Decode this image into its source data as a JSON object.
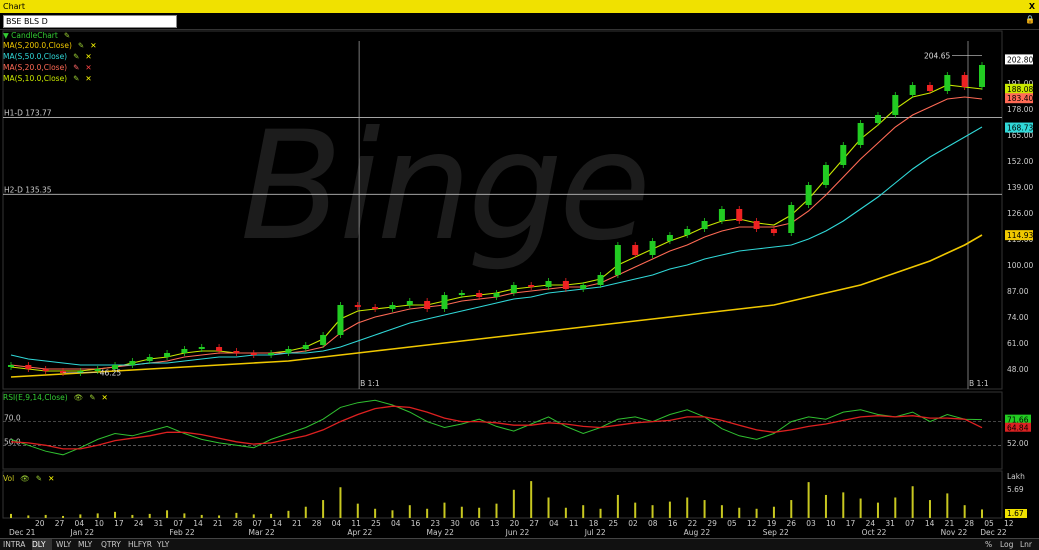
{
  "window": {
    "title": "Chart",
    "close_label": "X"
  },
  "symbol": {
    "value": "BSE BLS D"
  },
  "indicators": {
    "candle": "CandleChart",
    "ma200": "MA(S,200.0,Close)",
    "ma50": "MA(S,50.0,Close)",
    "ma20": "MA(S,20.0,Close)",
    "ma10": "MA(S,10.0,Close)",
    "rsi": "RSI(E,9,14,Close)",
    "vol": "Vol"
  },
  "watermark": "Binge",
  "colors": {
    "up": "#22cc22",
    "down": "#ee2222",
    "ma200": "#f0c800",
    "ma50": "#30d8d8",
    "ma20": "#ff6a55",
    "ma10": "#c8e800",
    "rsi_line": "#30c030",
    "rsi_avg": "#dd2020",
    "volume": "#c8c820",
    "titlebar": "#f0e100"
  },
  "chart_data": [
    {
      "type": "candlestick",
      "title": "BSE BLS D",
      "y_ticks": [
        202.8,
        191.0,
        178.0,
        165.0,
        152.0,
        139.0,
        126.0,
        113.0,
        100.0,
        87.0,
        74.0,
        61.0,
        48.0
      ],
      "ylim": [
        38,
        212
      ],
      "x_tick_labels": [
        "20",
        "27",
        "04",
        "10",
        "17",
        "24",
        "31",
        "07",
        "14",
        "21",
        "28",
        "07",
        "14",
        "21",
        "28",
        "04",
        "11",
        "25",
        "04",
        "16",
        "23",
        "30",
        "06",
        "13",
        "20",
        "27",
        "04",
        "11",
        "18",
        "25",
        "02",
        "08",
        "16",
        "22",
        "29",
        "05",
        "12",
        "19",
        "26",
        "03",
        "10",
        "17",
        "24",
        "31",
        "07",
        "14",
        "21",
        "28",
        "05",
        "12"
      ],
      "month_labels": [
        "Dec 21",
        "Jan 22",
        "Feb 22",
        "Mar 22",
        "Apr 22",
        "May 22",
        "Jun 22",
        "Jul 22",
        "Aug 22",
        "Sep 22",
        "Oct 22",
        "Nov 22",
        "Dec 22"
      ],
      "horizontal_lines": [
        {
          "label": "H1-D 173.77",
          "value": 173.77
        },
        {
          "label": "H2-D 135.35",
          "value": 135.35
        }
      ],
      "annotations": [
        {
          "text": "204.65",
          "value": 204.65
        },
        {
          "text": "46.25",
          "value": 46.25
        }
      ],
      "vertical_markers": [
        "B 1:1",
        "B 1:1"
      ],
      "last_value_labels": {
        "price_high": "202.80",
        "ma10": "188.08",
        "ma20": "183.40",
        "ma50": "168.73",
        "ma200": "114.93"
      },
      "series": [
        {
          "name": "CandleChart",
          "values": [
            50,
            48,
            47,
            46,
            47,
            48,
            50,
            52,
            54,
            56,
            58,
            59,
            57,
            56,
            55,
            56,
            58,
            60,
            65,
            80,
            79,
            78,
            80,
            82,
            78,
            85,
            86,
            84,
            86,
            90,
            89,
            92,
            88,
            90,
            95,
            110,
            105,
            112,
            115,
            118,
            122,
            128,
            122,
            118,
            116,
            130,
            140,
            150,
            160,
            171,
            175,
            185,
            190,
            187,
            195,
            189,
            200
          ]
        },
        {
          "name": "MA(S,10.0,Close)",
          "values": [
            49,
            48,
            47,
            47,
            47,
            48,
            49,
            51,
            53,
            54,
            56,
            57,
            57,
            56,
            56,
            56,
            57,
            59,
            63,
            73,
            77,
            78,
            79,
            80,
            80,
            82,
            84,
            85,
            86,
            88,
            89,
            90,
            90,
            91,
            93,
            100,
            104,
            108,
            112,
            115,
            119,
            122,
            123,
            121,
            120,
            125,
            133,
            143,
            153,
            163,
            170,
            178,
            184,
            186,
            190,
            189,
            188
          ]
        },
        {
          "name": "MA(S,20.0,Close)",
          "values": [
            50,
            49,
            48,
            48,
            48,
            48,
            49,
            50,
            51,
            52,
            54,
            55,
            56,
            56,
            56,
            56,
            56,
            57,
            59,
            66,
            71,
            74,
            76,
            78,
            79,
            80,
            82,
            83,
            84,
            86,
            87,
            88,
            89,
            89,
            91,
            95,
            99,
            103,
            107,
            110,
            114,
            117,
            119,
            119,
            119,
            121,
            127,
            135,
            144,
            153,
            161,
            169,
            175,
            179,
            183,
            184,
            183
          ]
        },
        {
          "name": "MA(S,50.0,Close)",
          "values": [
            55,
            53,
            52,
            51,
            50,
            50,
            50,
            50,
            51,
            51,
            52,
            53,
            54,
            54,
            55,
            55,
            56,
            56,
            57,
            59,
            62,
            65,
            68,
            71,
            73,
            75,
            77,
            79,
            81,
            83,
            84,
            86,
            87,
            88,
            89,
            91,
            93,
            95,
            98,
            100,
            103,
            105,
            107,
            108,
            109,
            110,
            113,
            117,
            122,
            128,
            134,
            141,
            148,
            154,
            159,
            164,
            169
          ]
        },
        {
          "name": "MA(S,200.0,Close)",
          "values": [
            44,
            44.5,
            45,
            45.5,
            46,
            46.5,
            47,
            47.5,
            48,
            48.5,
            49,
            49.5,
            50,
            50.5,
            51,
            51.5,
            52,
            53,
            54,
            55,
            56,
            57,
            58,
            59,
            60,
            61,
            62,
            63,
            64,
            65,
            66,
            67,
            68,
            69,
            70,
            71,
            72,
            73,
            74,
            75,
            76,
            77,
            78,
            79,
            80,
            82,
            84,
            86,
            88,
            90,
            93,
            96,
            99,
            102,
            106,
            110,
            115
          ]
        }
      ]
    },
    {
      "type": "line",
      "title": "RSI(E,9,14,Close)",
      "y_ticks": [
        70.0,
        50.0
      ],
      "right_labels": [
        "71.66",
        "64.84",
        "52.00"
      ],
      "series": [
        {
          "name": "RSI",
          "values": [
            55,
            50,
            45,
            42,
            48,
            55,
            60,
            58,
            62,
            66,
            60,
            55,
            52,
            50,
            48,
            55,
            60,
            65,
            72,
            82,
            86,
            88,
            84,
            78,
            70,
            65,
            68,
            72,
            66,
            62,
            68,
            74,
            66,
            60,
            65,
            72,
            74,
            70,
            76,
            80,
            74,
            64,
            58,
            55,
            60,
            70,
            74,
            72,
            78,
            80,
            76,
            74,
            78,
            70,
            76,
            72,
            71.66
          ]
        },
        {
          "name": "Average",
          "values": [
            53,
            52,
            50,
            47,
            47,
            50,
            54,
            56,
            58,
            61,
            61,
            59,
            56,
            53,
            51,
            52,
            55,
            58,
            63,
            70,
            76,
            81,
            83,
            82,
            78,
            73,
            70,
            70,
            69,
            67,
            67,
            69,
            68,
            66,
            65,
            67,
            69,
            70,
            71,
            74,
            74,
            71,
            67,
            63,
            61,
            63,
            66,
            68,
            71,
            74,
            75,
            74,
            75,
            73,
            73,
            72,
            64.84
          ]
        }
      ]
    },
    {
      "type": "bar",
      "title": "Vol",
      "y_ticks": [
        5.69
      ],
      "y_unit": "Lakh",
      "right_labels": [
        "1.67"
      ],
      "series": [
        {
          "name": "Vol",
          "values": [
            0.8,
            0.5,
            0.6,
            0.4,
            0.7,
            0.9,
            1.2,
            0.6,
            0.8,
            1.5,
            0.9,
            0.6,
            0.5,
            1.0,
            0.7,
            0.8,
            1.4,
            2.2,
            3.5,
            6.0,
            2.8,
            1.8,
            1.5,
            2.5,
            1.8,
            3.0,
            2.2,
            2.0,
            2.8,
            5.5,
            7.2,
            4.0,
            2.0,
            2.5,
            1.8,
            4.5,
            3.0,
            2.5,
            3.2,
            4.0,
            3.5,
            2.5,
            2.0,
            1.8,
            2.2,
            3.5,
            7.0,
            4.5,
            5.0,
            3.8,
            3.0,
            4.0,
            6.2,
            3.5,
            4.8,
            2.5,
            1.67
          ]
        }
      ]
    }
  ],
  "bottom_tabs": [
    "INTRA",
    "DLY",
    "WLY",
    "MLY",
    "QTRY",
    "HLFYR",
    "YLY"
  ],
  "active_tab": "DLY",
  "right_tabs": [
    "%",
    "Log",
    "Lnr"
  ]
}
